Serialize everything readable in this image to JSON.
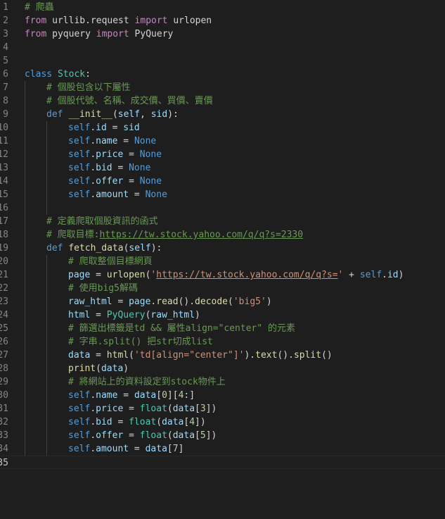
{
  "editor": {
    "lines": [
      {
        "n": "1",
        "indent": 0,
        "tokens": [
          {
            "t": "# 爬蟲",
            "c": "com"
          }
        ]
      },
      {
        "n": "2",
        "indent": 0,
        "tokens": [
          {
            "t": "from",
            "c": "kw"
          },
          {
            "t": " urllib.request ",
            "c": ""
          },
          {
            "t": "import",
            "c": "kw"
          },
          {
            "t": " urlopen",
            "c": ""
          }
        ]
      },
      {
        "n": "3",
        "indent": 0,
        "tokens": [
          {
            "t": "from",
            "c": "kw"
          },
          {
            "t": " pyquery ",
            "c": ""
          },
          {
            "t": "import",
            "c": "kw"
          },
          {
            "t": " PyQuery",
            "c": ""
          }
        ]
      },
      {
        "n": "4",
        "indent": 0,
        "tokens": []
      },
      {
        "n": "5",
        "indent": 0,
        "tokens": []
      },
      {
        "n": "6",
        "indent": 0,
        "tokens": [
          {
            "t": "class",
            "c": "def"
          },
          {
            "t": " ",
            "c": ""
          },
          {
            "t": "Stock",
            "c": "cls"
          },
          {
            "t": ":",
            "c": ""
          }
        ]
      },
      {
        "n": "7",
        "indent": 1,
        "tokens": [
          {
            "t": "# 個股包含以下屬性",
            "c": "com"
          }
        ]
      },
      {
        "n": "8",
        "indent": 1,
        "tokens": [
          {
            "t": "# 個股代號、名稱、成交價、買價、賣價",
            "c": "com"
          }
        ]
      },
      {
        "n": "9",
        "indent": 1,
        "tokens": [
          {
            "t": "def",
            "c": "def"
          },
          {
            "t": " ",
            "c": ""
          },
          {
            "t": "__init__",
            "c": "fn"
          },
          {
            "t": "(",
            "c": ""
          },
          {
            "t": "self",
            "c": "var"
          },
          {
            "t": ", ",
            "c": ""
          },
          {
            "t": "sid",
            "c": "var"
          },
          {
            "t": "):",
            "c": ""
          }
        ]
      },
      {
        "n": "10",
        "indent": 2,
        "tokens": [
          {
            "t": "self",
            "c": "self"
          },
          {
            "t": ".",
            "c": ""
          },
          {
            "t": "id",
            "c": "var"
          },
          {
            "t": " = ",
            "c": ""
          },
          {
            "t": "sid",
            "c": "var"
          }
        ]
      },
      {
        "n": "11",
        "indent": 2,
        "tokens": [
          {
            "t": "self",
            "c": "self"
          },
          {
            "t": ".",
            "c": ""
          },
          {
            "t": "name",
            "c": "var"
          },
          {
            "t": " = ",
            "c": ""
          },
          {
            "t": "None",
            "c": "def"
          }
        ]
      },
      {
        "n": "12",
        "indent": 2,
        "tokens": [
          {
            "t": "self",
            "c": "self"
          },
          {
            "t": ".",
            "c": ""
          },
          {
            "t": "price",
            "c": "var"
          },
          {
            "t": " = ",
            "c": ""
          },
          {
            "t": "None",
            "c": "def"
          }
        ]
      },
      {
        "n": "13",
        "indent": 2,
        "tokens": [
          {
            "t": "self",
            "c": "self"
          },
          {
            "t": ".",
            "c": ""
          },
          {
            "t": "bid",
            "c": "var"
          },
          {
            "t": " = ",
            "c": ""
          },
          {
            "t": "None",
            "c": "def"
          }
        ]
      },
      {
        "n": "14",
        "indent": 2,
        "tokens": [
          {
            "t": "self",
            "c": "self"
          },
          {
            "t": ".",
            "c": ""
          },
          {
            "t": "offer",
            "c": "var"
          },
          {
            "t": " = ",
            "c": ""
          },
          {
            "t": "None",
            "c": "def"
          }
        ]
      },
      {
        "n": "15",
        "indent": 2,
        "tokens": [
          {
            "t": "self",
            "c": "self"
          },
          {
            "t": ".",
            "c": ""
          },
          {
            "t": "amount",
            "c": "var"
          },
          {
            "t": " = ",
            "c": ""
          },
          {
            "t": "None",
            "c": "def"
          }
        ]
      },
      {
        "n": "16",
        "indent": 2,
        "tokens": []
      },
      {
        "n": "17",
        "indent": 1,
        "tokens": [
          {
            "t": "# 定義爬取個股資訊的函式",
            "c": "com"
          }
        ]
      },
      {
        "n": "18",
        "indent": 1,
        "tokens": [
          {
            "t": "# 爬取目標:",
            "c": "com"
          },
          {
            "t": "https://tw.stock.yahoo.com/q/q?s=2330",
            "c": "com url"
          }
        ]
      },
      {
        "n": "19",
        "indent": 1,
        "tokens": [
          {
            "t": "def",
            "c": "def"
          },
          {
            "t": " ",
            "c": ""
          },
          {
            "t": "fetch_data",
            "c": "fn"
          },
          {
            "t": "(",
            "c": ""
          },
          {
            "t": "self",
            "c": "var"
          },
          {
            "t": "):",
            "c": ""
          }
        ]
      },
      {
        "n": "20",
        "indent": 2,
        "tokens": [
          {
            "t": "# 爬取整個目標網頁",
            "c": "com"
          }
        ]
      },
      {
        "n": "21",
        "indent": 2,
        "tokens": [
          {
            "t": "page",
            "c": "var"
          },
          {
            "t": " = ",
            "c": ""
          },
          {
            "t": "urlopen",
            "c": "fn"
          },
          {
            "t": "(",
            "c": ""
          },
          {
            "t": "'",
            "c": "str"
          },
          {
            "t": "https://tw.stock.yahoo.com/q/q?s=",
            "c": "str url"
          },
          {
            "t": "'",
            "c": "str"
          },
          {
            "t": " + ",
            "c": ""
          },
          {
            "t": "self",
            "c": "self"
          },
          {
            "t": ".",
            "c": ""
          },
          {
            "t": "id",
            "c": "var"
          },
          {
            "t": ")",
            "c": ""
          }
        ]
      },
      {
        "n": "22",
        "indent": 2,
        "tokens": [
          {
            "t": "# 使用big5解碼",
            "c": "com"
          }
        ]
      },
      {
        "n": "23",
        "indent": 2,
        "tokens": [
          {
            "t": "raw_html",
            "c": "var"
          },
          {
            "t": " = ",
            "c": ""
          },
          {
            "t": "page",
            "c": "var"
          },
          {
            "t": ".",
            "c": ""
          },
          {
            "t": "read",
            "c": "fn"
          },
          {
            "t": "().",
            "c": ""
          },
          {
            "t": "decode",
            "c": "fn"
          },
          {
            "t": "(",
            "c": ""
          },
          {
            "t": "'big5'",
            "c": "str"
          },
          {
            "t": ")",
            "c": ""
          }
        ]
      },
      {
        "n": "24",
        "indent": 2,
        "tokens": [
          {
            "t": "html",
            "c": "var"
          },
          {
            "t": " = ",
            "c": ""
          },
          {
            "t": "PyQuery",
            "c": "cls"
          },
          {
            "t": "(",
            "c": ""
          },
          {
            "t": "raw_html",
            "c": "var"
          },
          {
            "t": ")",
            "c": ""
          }
        ]
      },
      {
        "n": "25",
        "indent": 2,
        "tokens": [
          {
            "t": "# 篩選出標籤是td && 屬性align=\"center\" 的元素",
            "c": "com"
          }
        ]
      },
      {
        "n": "26",
        "indent": 2,
        "tokens": [
          {
            "t": "# 字串.split() 把str切成list",
            "c": "com"
          }
        ]
      },
      {
        "n": "27",
        "indent": 2,
        "tokens": [
          {
            "t": "data",
            "c": "var"
          },
          {
            "t": " = ",
            "c": ""
          },
          {
            "t": "html",
            "c": "fn"
          },
          {
            "t": "(",
            "c": ""
          },
          {
            "t": "'td[align=\"center\"]'",
            "c": "str"
          },
          {
            "t": ").",
            "c": ""
          },
          {
            "t": "text",
            "c": "fn"
          },
          {
            "t": "().",
            "c": ""
          },
          {
            "t": "split",
            "c": "fn"
          },
          {
            "t": "()",
            "c": ""
          }
        ]
      },
      {
        "n": "28",
        "indent": 2,
        "tokens": [
          {
            "t": "print",
            "c": "fn"
          },
          {
            "t": "(",
            "c": ""
          },
          {
            "t": "data",
            "c": "var"
          },
          {
            "t": ")",
            "c": ""
          }
        ]
      },
      {
        "n": "29",
        "indent": 2,
        "tokens": [
          {
            "t": "# 將網站上的資料設定到stock物件上",
            "c": "com"
          }
        ]
      },
      {
        "n": "30",
        "indent": 2,
        "tokens": [
          {
            "t": "self",
            "c": "self"
          },
          {
            "t": ".",
            "c": ""
          },
          {
            "t": "name",
            "c": "var"
          },
          {
            "t": " = ",
            "c": ""
          },
          {
            "t": "data",
            "c": "var"
          },
          {
            "t": "[",
            "c": ""
          },
          {
            "t": "0",
            "c": "num"
          },
          {
            "t": "][",
            "c": ""
          },
          {
            "t": "4",
            "c": "num"
          },
          {
            "t": ":]",
            "c": ""
          }
        ]
      },
      {
        "n": "31",
        "indent": 2,
        "tokens": [
          {
            "t": "self",
            "c": "self"
          },
          {
            "t": ".",
            "c": ""
          },
          {
            "t": "price",
            "c": "var"
          },
          {
            "t": " = ",
            "c": ""
          },
          {
            "t": "float",
            "c": "cls"
          },
          {
            "t": "(",
            "c": ""
          },
          {
            "t": "data",
            "c": "var"
          },
          {
            "t": "[",
            "c": ""
          },
          {
            "t": "3",
            "c": "num"
          },
          {
            "t": "])",
            "c": ""
          }
        ]
      },
      {
        "n": "32",
        "indent": 2,
        "tokens": [
          {
            "t": "self",
            "c": "self"
          },
          {
            "t": ".",
            "c": ""
          },
          {
            "t": "bid",
            "c": "var"
          },
          {
            "t": " = ",
            "c": ""
          },
          {
            "t": "float",
            "c": "cls"
          },
          {
            "t": "(",
            "c": ""
          },
          {
            "t": "data",
            "c": "var"
          },
          {
            "t": "[",
            "c": ""
          },
          {
            "t": "4",
            "c": "num"
          },
          {
            "t": "])",
            "c": ""
          }
        ]
      },
      {
        "n": "33",
        "indent": 2,
        "tokens": [
          {
            "t": "self",
            "c": "self"
          },
          {
            "t": ".",
            "c": ""
          },
          {
            "t": "offer",
            "c": "var"
          },
          {
            "t": " = ",
            "c": ""
          },
          {
            "t": "float",
            "c": "cls"
          },
          {
            "t": "(",
            "c": ""
          },
          {
            "t": "data",
            "c": "var"
          },
          {
            "t": "[",
            "c": ""
          },
          {
            "t": "5",
            "c": "num"
          },
          {
            "t": "])",
            "c": ""
          }
        ]
      },
      {
        "n": "34",
        "indent": 2,
        "tokens": [
          {
            "t": "self",
            "c": "self"
          },
          {
            "t": ".",
            "c": ""
          },
          {
            "t": "amount",
            "c": "var"
          },
          {
            "t": " = ",
            "c": ""
          },
          {
            "t": "data",
            "c": "var"
          },
          {
            "t": "[",
            "c": ""
          },
          {
            "t": "7",
            "c": "num"
          },
          {
            "t": "]",
            "c": ""
          }
        ]
      },
      {
        "n": "35",
        "indent": 0,
        "tokens": [],
        "current": true
      }
    ]
  }
}
